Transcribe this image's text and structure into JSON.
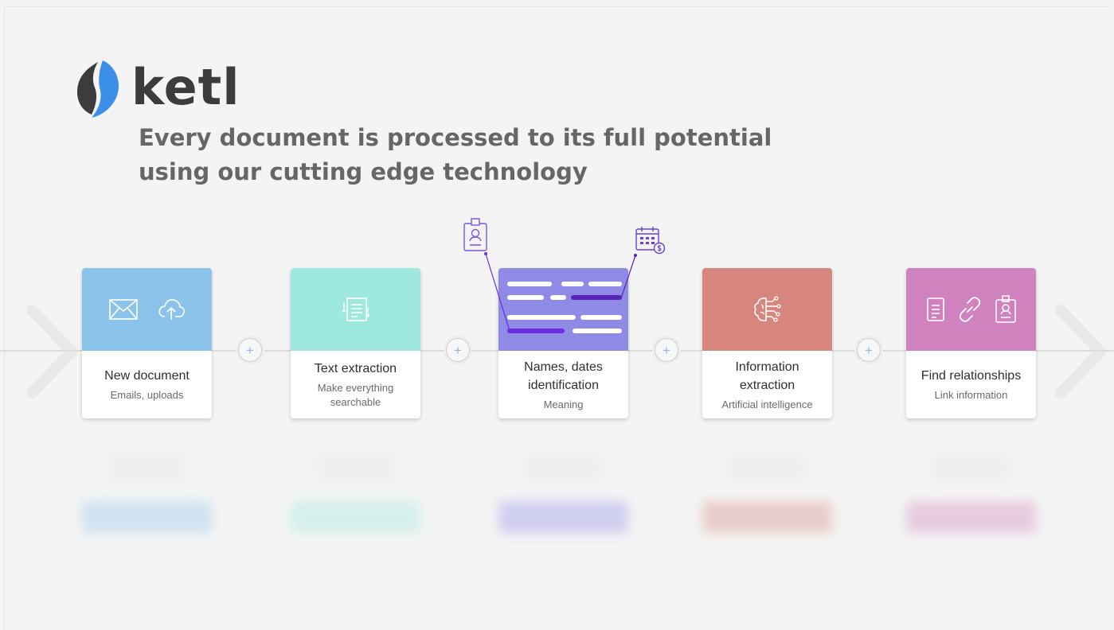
{
  "brand": {
    "name": "ketl"
  },
  "tagline": {
    "line1": "Every document is processed to its full potential",
    "line2": "using our cutting edge technology"
  },
  "steps": [
    {
      "title": "New document",
      "subtitle": "Emails, uploads",
      "color": "#8cc3ea",
      "icons": [
        "envelope-icon",
        "cloud-upload-icon"
      ]
    },
    {
      "title": "Text extraction",
      "subtitle": "Make everything searchable",
      "color": "#9ee8e0",
      "icons": [
        "text-extract-icon"
      ]
    },
    {
      "title": "Names, dates identification",
      "subtitle": "Meaning",
      "color": "#8f8ae6",
      "icons": [
        "highlighted-lines-icon"
      ]
    },
    {
      "title": "Information extraction",
      "subtitle": "Artificial intelligence",
      "color": "#d7867e",
      "icons": [
        "ai-brain-icon"
      ]
    },
    {
      "title": "Find relationships",
      "subtitle": "Link information",
      "color": "#cf82bd",
      "icons": [
        "document-icon",
        "link-icon",
        "id-badge-icon"
      ]
    }
  ],
  "floating_icons": [
    "id-badge-icon",
    "calendar-money-icon"
  ],
  "connector_icons": [
    "plus-icon",
    "plus-icon",
    "plus-icon",
    "plus-icon"
  ]
}
